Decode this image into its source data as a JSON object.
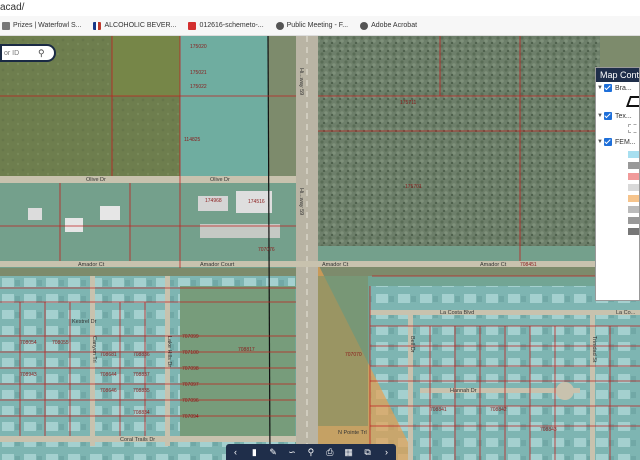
{
  "browser": {
    "url": "acad/",
    "bookmarks": [
      {
        "label": "Prizes | Waterfowl S...",
        "icon": "bookmark-icon",
        "color": "#777777"
      },
      {
        "label": "ALCOHOLIC BEVER...",
        "icon": "texas-flag-icon",
        "color": "#c0392b"
      },
      {
        "label": "012616-schemeto-...",
        "icon": "pdf-icon",
        "color": "#d32f2f"
      },
      {
        "label": "Public Meeting - F...",
        "icon": "globe-icon",
        "color": "#555555"
      },
      {
        "label": "Adobe Acrobat",
        "icon": "globe-icon",
        "color": "#555555"
      }
    ]
  },
  "search": {
    "placeholder": "or ID"
  },
  "map": {
    "streets": {
      "main_nb": "Hi...way 59",
      "main_sb": "Hi...way 59",
      "olive_w": "Olive Dr",
      "olive_e": "Olive Dr",
      "amador_w": "Amador Ct",
      "amador_c": "Amador Court",
      "amador_e": "Amador Ct",
      "amador_e2": "Amador Ct",
      "la_costa": "La Costa Blvd",
      "la_costa_e": "La Co...",
      "coral_trail": "Coral Trails Dr",
      "kestrel": "Kestrel Dr",
      "canyon": "Canyon Trl",
      "lake_hills": "Lake Hills Dr",
      "hannah": "Hannah Dr",
      "n_pointe": "N Pointe Trl",
      "trinidad": "Trinidad St",
      "bell": "Bell Dr"
    },
    "parcels": [
      {
        "id": "175020",
        "area": "nw"
      },
      {
        "id": "175021",
        "area": "nw"
      },
      {
        "id": "175022",
        "area": "nw"
      },
      {
        "id": "114825",
        "area": "nw"
      },
      {
        "id": "174968",
        "area": "w"
      },
      {
        "id": "174516",
        "area": "w"
      },
      {
        "id": "707076",
        "area": "w"
      },
      {
        "id": "175711",
        "area": "ne"
      },
      {
        "id": "175701",
        "area": "ne"
      },
      {
        "id": "707070",
        "area": "c"
      },
      {
        "id": "708451",
        "area": "se"
      },
      {
        "id": "708054",
        "area": "sw"
      },
      {
        "id": "708055",
        "area": "sw"
      },
      {
        "id": "708943",
        "area": "sw"
      },
      {
        "id": "708681",
        "area": "sw"
      },
      {
        "id": "708836",
        "area": "sw"
      },
      {
        "id": "708644",
        "area": "sw"
      },
      {
        "id": "708837",
        "area": "sw"
      },
      {
        "id": "708646",
        "area": "sw"
      },
      {
        "id": "708835",
        "area": "sw"
      },
      {
        "id": "708834",
        "area": "sw"
      },
      {
        "id": "707099",
        "area": "sw"
      },
      {
        "id": "707100",
        "area": "sw"
      },
      {
        "id": "707098",
        "area": "sw"
      },
      {
        "id": "707097",
        "area": "sw"
      },
      {
        "id": "707096",
        "area": "sw"
      },
      {
        "id": "707094",
        "area": "sw"
      },
      {
        "id": "708817",
        "area": "s"
      },
      {
        "id": "708841",
        "area": "se"
      },
      {
        "id": "708842",
        "area": "se"
      },
      {
        "id": "708843",
        "area": "se"
      }
    ]
  },
  "panel": {
    "title": "Map Contents",
    "layers": [
      {
        "label": "Bra...",
        "swatches": [
          "#111111"
        ]
      },
      {
        "label": "Tex...",
        "swatches": [
          "#cccccc"
        ]
      },
      {
        "label": "FEM...",
        "swatches": [
          "#a7dff0",
          "#999999",
          "#f19a9a",
          "#d9d9d9",
          "#f6c48c",
          "#bbbbbb",
          "#999999",
          "#777777"
        ]
      }
    ]
  },
  "toolbar": {
    "tools": [
      "collapse-icon",
      "bookmark-icon",
      "draw-icon",
      "measure-icon",
      "search-icon",
      "print-icon",
      "layers-icon",
      "share-icon",
      "expand-icon"
    ]
  },
  "colors": {
    "flood_teal": "#5fd6e0",
    "flood_orange": "#e8a050",
    "parcel_line": "#c02020",
    "panel_header": "#1f2e4a"
  }
}
